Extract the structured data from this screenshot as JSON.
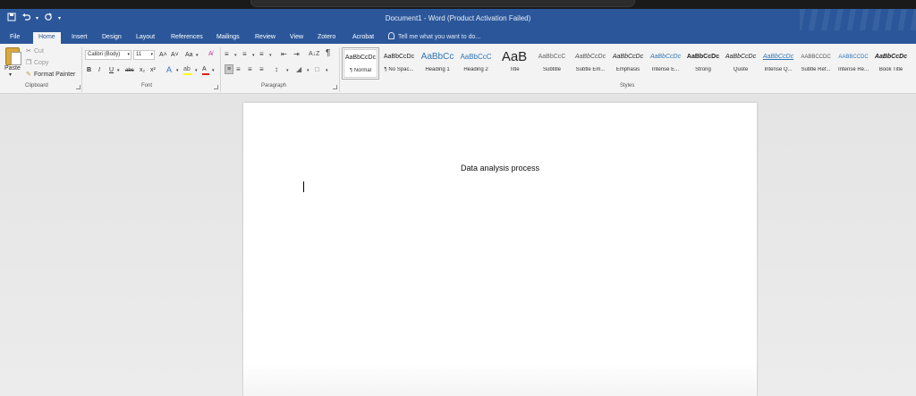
{
  "window": {
    "title": "Document1 - Word (Product Activation Failed)"
  },
  "qat": {
    "save_icon": "save-icon",
    "undo_icon": "undo-icon",
    "redo_icon": "repeat-icon",
    "customize_icon": "customize-qat-icon"
  },
  "tabs": [
    {
      "label": "File"
    },
    {
      "label": "Home"
    },
    {
      "label": "Insert"
    },
    {
      "label": "Design"
    },
    {
      "label": "Layout"
    },
    {
      "label": "References"
    },
    {
      "label": "Mailings"
    },
    {
      "label": "Review"
    },
    {
      "label": "View"
    },
    {
      "label": "Zotero"
    },
    {
      "label": "Acrobat"
    }
  ],
  "tell_me": {
    "placeholder": "Tell me what you want to do..."
  },
  "clipboard": {
    "paste": "Paste",
    "cut": "Cut",
    "copy": "Copy",
    "format_painter": "Format Painter",
    "group_label": "Clipboard"
  },
  "font": {
    "family": "Calibri (Body)",
    "size": "11",
    "grow": "A˄",
    "shrink": "A˅",
    "change_case": "Aa",
    "bold": "B",
    "italic": "I",
    "underline": "U",
    "strikethrough": "abc",
    "subscript": "x₂",
    "superscript": "x²",
    "group_label": "Font"
  },
  "paragraph": {
    "group_label": "Paragraph",
    "show_marks": "¶",
    "sort": "A↓Z"
  },
  "styles": {
    "group_label": "Styles",
    "items": [
      {
        "sample": "AaBbCcDc",
        "name": "¶ Normal"
      },
      {
        "sample": "AaBbCcDc",
        "name": "¶ No Spac..."
      },
      {
        "sample": "AaBbCc",
        "name": "Heading 1"
      },
      {
        "sample": "AaBbCcC",
        "name": "Heading 2"
      },
      {
        "sample": "AaB",
        "name": "Title"
      },
      {
        "sample": "AaBbCcC",
        "name": "Subtitle"
      },
      {
        "sample": "AaBbCcDc",
        "name": "Subtle Em..."
      },
      {
        "sample": "AaBbCcDc",
        "name": "Emphasis"
      },
      {
        "sample": "AaBbCcDc",
        "name": "Intense E..."
      },
      {
        "sample": "AaBbCcDc",
        "name": "Strong"
      },
      {
        "sample": "AaBbCcDc",
        "name": "Quote"
      },
      {
        "sample": "AaBbCcDc",
        "name": "Intense Q..."
      },
      {
        "sample": "AABBCCDC",
        "name": "Subtle Ref..."
      },
      {
        "sample": "AABBCCDC",
        "name": "Intense Re..."
      },
      {
        "sample": "AaBbCcDc",
        "name": "Book Title"
      }
    ]
  },
  "document": {
    "heading": "Data analysis process"
  },
  "colors": {
    "word_blue": "#2b579a",
    "ribbon_bg": "#f3f3f3",
    "canvas_bg": "#e6e6e6"
  }
}
